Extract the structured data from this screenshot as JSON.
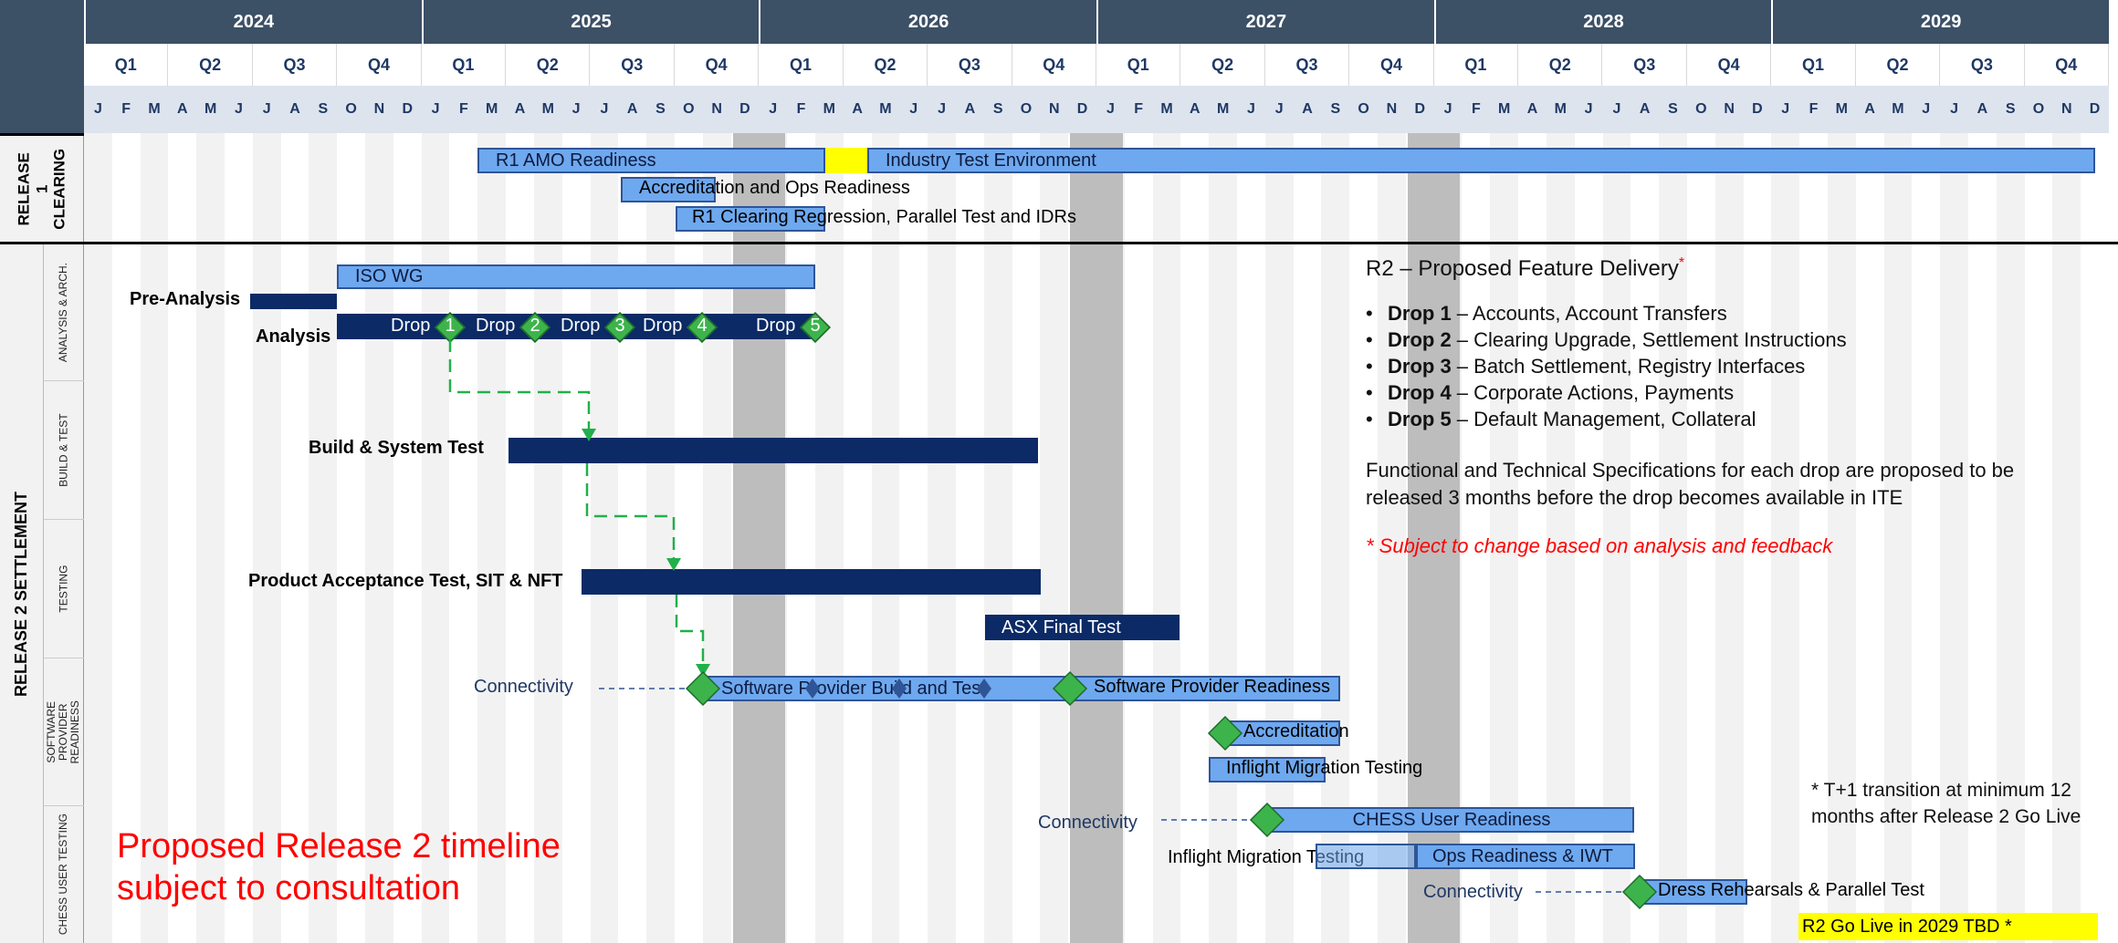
{
  "timeline": {
    "years": [
      "2024",
      "2025",
      "2026",
      "2027",
      "2028",
      "2029"
    ],
    "quarters": [
      "Q1",
      "Q2",
      "Q3",
      "Q4"
    ],
    "months": [
      "J",
      "F",
      "M",
      "A",
      "M",
      "J",
      "J",
      "A",
      "S",
      "O",
      "N",
      "D"
    ]
  },
  "sections": {
    "release1": "RELEASE 1 CLEARING",
    "release2": "RELEASE 2 SETTLEMENT"
  },
  "swimlanes": {
    "analysis": "ANALYSIS & ARCH.",
    "build": "BUILD & TEST",
    "testing": "TESTING",
    "software": "SOFTWARE PROVIDER READINESS",
    "chess": "CHESS USER TESTING"
  },
  "release1": {
    "amo": "R1 AMO Readiness",
    "ite": "Industry Test Environment",
    "accreditation": "Accreditation and Ops Readiness",
    "regression": "R1 Clearing Regression, Parallel Test and IDRs"
  },
  "analysis": {
    "iso_wg": "ISO WG",
    "pre_analysis": "Pre-Analysis",
    "analysis": "Analysis",
    "drops": [
      "Drop",
      "Drop",
      "Drop",
      "Drop",
      "Drop"
    ],
    "drop_numbers": [
      "1",
      "2",
      "3",
      "4",
      "5"
    ]
  },
  "build": {
    "label": "Build & System Test"
  },
  "testing": {
    "pat": "Product Acceptance Test, SIT & NFT",
    "asx": "ASX Final Test"
  },
  "software": {
    "connectivity": "Connectivity",
    "build_test": "Software Provider Build and Test",
    "readiness": "Software Provider Readiness",
    "accreditation": "Accreditation",
    "inflight": "Inflight Migration Testing"
  },
  "chess": {
    "connectivity": "Connectivity",
    "user_readiness": "CHESS User Readiness",
    "inflight": "Inflight Migration Testing",
    "ops": "Ops Readiness & IWT",
    "connectivity2": "Connectivity",
    "dress": "Dress Rehearsals & Parallel Test"
  },
  "feature_panel": {
    "title": "R2 – Proposed Feature Delivery",
    "asterisk": "*",
    "items": [
      {
        "name": "Drop 1",
        "desc": "– Accounts, Account Transfers"
      },
      {
        "name": "Drop 2",
        "desc": "– Clearing Upgrade, Settlement Instructions"
      },
      {
        "name": "Drop 3",
        "desc": "– Batch Settlement, Registry Interfaces"
      },
      {
        "name": "Drop 4",
        "desc": "– Corporate Actions, Payments"
      },
      {
        "name": "Drop 5",
        "desc": "– Default Management, Collateral"
      }
    ],
    "specs": "Functional and Technical Specifications for each drop are proposed to be released 3 months before the drop becomes available in ITE",
    "note": "* Subject to change based on analysis and feedback"
  },
  "t1_note": "* T+1 transition at minimum 12 months after Release 2 Go Live",
  "watermark": "Proposed Release 2 timeline subject to consultation",
  "go_live": "R2 Go Live in 2029 TBD *",
  "colors": {
    "header": "#3c5066",
    "bar_light": "#6ea8ef",
    "bar_dark": "#0b2a66",
    "milestone": "#3cb44b",
    "highlight": "#ffff00",
    "red": "#ff0000",
    "grey_band": "#bdbdbd"
  }
}
